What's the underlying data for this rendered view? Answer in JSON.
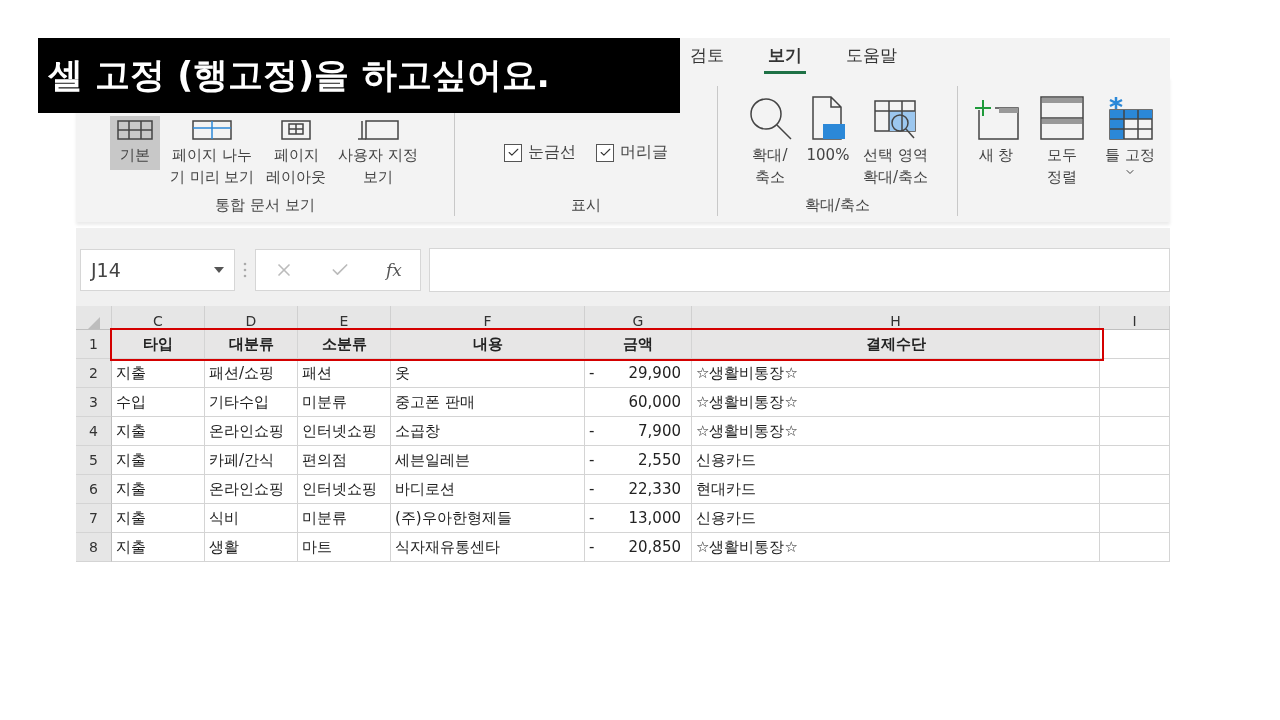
{
  "banner": {
    "text": "셀 고정 (행고정)을 하고싶어요."
  },
  "tabs": [
    {
      "label": "검토",
      "selected": false
    },
    {
      "label": "보기",
      "selected": true
    },
    {
      "label": "도움말",
      "selected": false
    }
  ],
  "ribbon": {
    "groups": [
      {
        "label": "통합 문서 보기",
        "buttons": [
          {
            "label": "기본",
            "kind": "normal",
            "selected": true
          },
          {
            "label": "페이지 나누\n기 미리 보기",
            "kind": "page-break",
            "selected": false
          },
          {
            "label": "페이지\n레이아웃",
            "kind": "page-layout",
            "selected": false
          },
          {
            "label": "사용자 지정\n보기",
            "kind": "custom-view",
            "selected": false
          }
        ]
      },
      {
        "label": "표시",
        "checkboxes": [
          {
            "label": "눈금선",
            "checked": true
          },
          {
            "label": "머리글",
            "checked": true
          }
        ]
      },
      {
        "label": "확대/축소",
        "buttons": [
          {
            "label": "확대/\n축소",
            "kind": "zoom",
            "selected": false
          },
          {
            "label": "100%",
            "kind": "zoom-100",
            "selected": false
          },
          {
            "label": "선택 영역\n확대/축소",
            "kind": "zoom-selection",
            "selected": false
          }
        ]
      },
      {
        "buttons": [
          {
            "label": "새 창",
            "kind": "new-window",
            "selected": false
          },
          {
            "label": "모두\n정렬",
            "kind": "arrange-all",
            "selected": false
          },
          {
            "label": "틀 고정",
            "kind": "freeze-panes",
            "selected": false,
            "dropdown": true
          }
        ]
      }
    ]
  },
  "formula_bar": {
    "name_box": "J14",
    "function_label": "fx"
  },
  "sheet": {
    "columns": [
      "C",
      "D",
      "E",
      "F",
      "G",
      "H",
      "I"
    ],
    "rows": [
      {
        "number": "1",
        "kind": "header",
        "highlighted": true,
        "cells": [
          "타입",
          "대분류",
          "소분류",
          "내용",
          "금액",
          "결제수단"
        ]
      },
      {
        "number": "2",
        "kind": "data",
        "highlighted": false,
        "cells": [
          "지출",
          "패션/쇼핑",
          "패션",
          "옷",
          "29,900",
          "☆생활비통장☆"
        ],
        "sign": "-"
      },
      {
        "number": "3",
        "kind": "data",
        "highlighted": false,
        "cells": [
          "수입",
          "기타수입",
          "미분류",
          "중고폰 판매",
          "60,000",
          "☆생활비통장☆"
        ]
      },
      {
        "number": "4",
        "kind": "data",
        "highlighted": false,
        "cells": [
          "지출",
          "온라인쇼핑",
          "인터넷쇼핑",
          "소곱창",
          "7,900",
          "☆생활비통장☆"
        ],
        "sign": "-"
      },
      {
        "number": "5",
        "kind": "data",
        "highlighted": false,
        "cells": [
          "지출",
          "카페/간식",
          "편의점",
          "세븐일레븐",
          "2,550",
          "신용카드"
        ],
        "sign": "-"
      },
      {
        "number": "6",
        "kind": "data",
        "highlighted": false,
        "cells": [
          "지출",
          "온라인쇼핑",
          "인터넷쇼핑",
          "바디로션",
          "22,330",
          "현대카드"
        ],
        "sign": "-"
      },
      {
        "number": "7",
        "kind": "data",
        "highlighted": false,
        "cells": [
          "지출",
          "식비",
          "미분류",
          "(주)우아한형제들",
          "13,000",
          "신용카드"
        ],
        "sign": "-"
      },
      {
        "number": "8",
        "kind": "data",
        "highlighted": false,
        "cells": [
          "지출",
          "생활",
          "마트",
          "식자재유통센타",
          "20,850",
          "☆생활비통장☆"
        ],
        "sign": "-"
      }
    ]
  }
}
